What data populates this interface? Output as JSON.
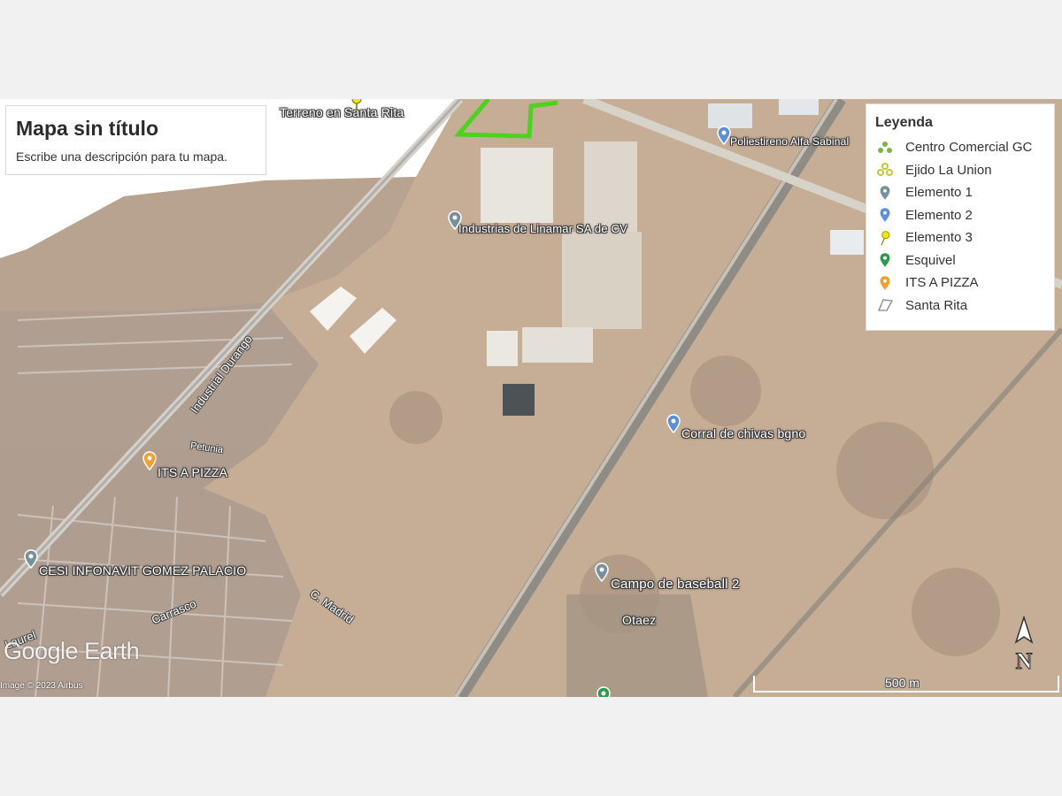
{
  "map": {
    "title": "Mapa sin título",
    "description": "Escribe una descripción para tu mapa.",
    "watermark": "Google Earth",
    "copyright": "Image © 2023 Airbus",
    "scale_label": "500 m",
    "north_label": "N"
  },
  "legend": {
    "title": "Leyenda",
    "items": [
      {
        "label": "Centro Comercial GC",
        "icon": "cluster-pins-icon",
        "color": "#7cb342"
      },
      {
        "label": "Ejido La Union",
        "icon": "cluster-pins-icon",
        "color": "#c0ca33"
      },
      {
        "label": "Elemento 1",
        "icon": "map-pin-icon",
        "color": "#78909c"
      },
      {
        "label": "Elemento 2",
        "icon": "map-pin-icon",
        "color": "#5c8fd6"
      },
      {
        "label": "Elemento 3",
        "icon": "pushpin-icon",
        "color": "#f2e600"
      },
      {
        "label": "Esquivel",
        "icon": "map-pin-icon",
        "color": "#2e9a4e"
      },
      {
        "label": "ITS A PIZZA",
        "icon": "map-pin-icon",
        "color": "#f0a030"
      },
      {
        "label": "Santa Rita",
        "icon": "polygon-icon",
        "color": "#ffffff"
      }
    ]
  },
  "places": {
    "terreno": "Terreno en Santa Rita",
    "poliestireno": "Poliestireno Alfa Sabinal",
    "linamar": "Industrias de Linamar SA de CV",
    "corral": "Corral de chivas bgno",
    "its_pizza": "ITS A PIZZA",
    "cesi": "CESI INFONAVIT GOMEZ PALACIO",
    "campo": "Campo de baseball 2",
    "otaez": "Otaez"
  },
  "streets": {
    "industrial": "Industrial Durango",
    "petunia": "Petunia",
    "carrasco": "Carrasco",
    "madrid": "C. Madrid",
    "laurel": "Laurel"
  },
  "colors": {
    "ground": "#c6b09d",
    "boundary_green": "#4cd21f",
    "pin_gray": "#78909c",
    "pin_blue": "#5c8fd6",
    "pin_orange": "#f0a030",
    "pin_green": "#2e9a4e"
  }
}
